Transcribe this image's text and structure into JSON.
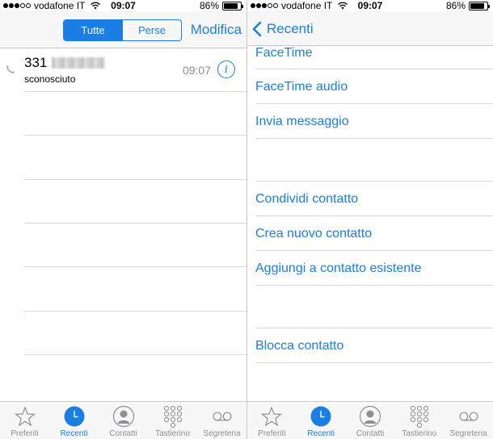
{
  "status": {
    "carrier": "vodafone IT",
    "time": "09:07",
    "battery": "86%",
    "battery_level": 0.86
  },
  "left": {
    "segments": [
      "Tutte",
      "Perse"
    ],
    "selected_segment": "Tutte",
    "nav_action": "Modifica",
    "call": {
      "number": "331",
      "label": "sconosciuto",
      "time": "09:07"
    }
  },
  "right": {
    "back_label": "Recenti",
    "options_group1": [
      "FaceTime",
      "FaceTime audio",
      "Invia messaggio"
    ],
    "options_group2": [
      "Condividi contatto",
      "Crea nuovo contatto",
      "Aggiungi a contatto esistente"
    ],
    "options_group3": [
      "Blocca contatto"
    ]
  },
  "tabs": [
    {
      "label": "Preferiti",
      "icon": "star-icon"
    },
    {
      "label": "Recenti",
      "icon": "clock-icon"
    },
    {
      "label": "Contatti",
      "icon": "person-icon"
    },
    {
      "label": "Tastierino",
      "icon": "keypad-icon"
    },
    {
      "label": "Segreteria",
      "icon": "voicemail-icon"
    }
  ],
  "active_tab": "Recenti",
  "colors": {
    "accent": "#1a7ee4",
    "secondary_text": "#8e8e93"
  }
}
